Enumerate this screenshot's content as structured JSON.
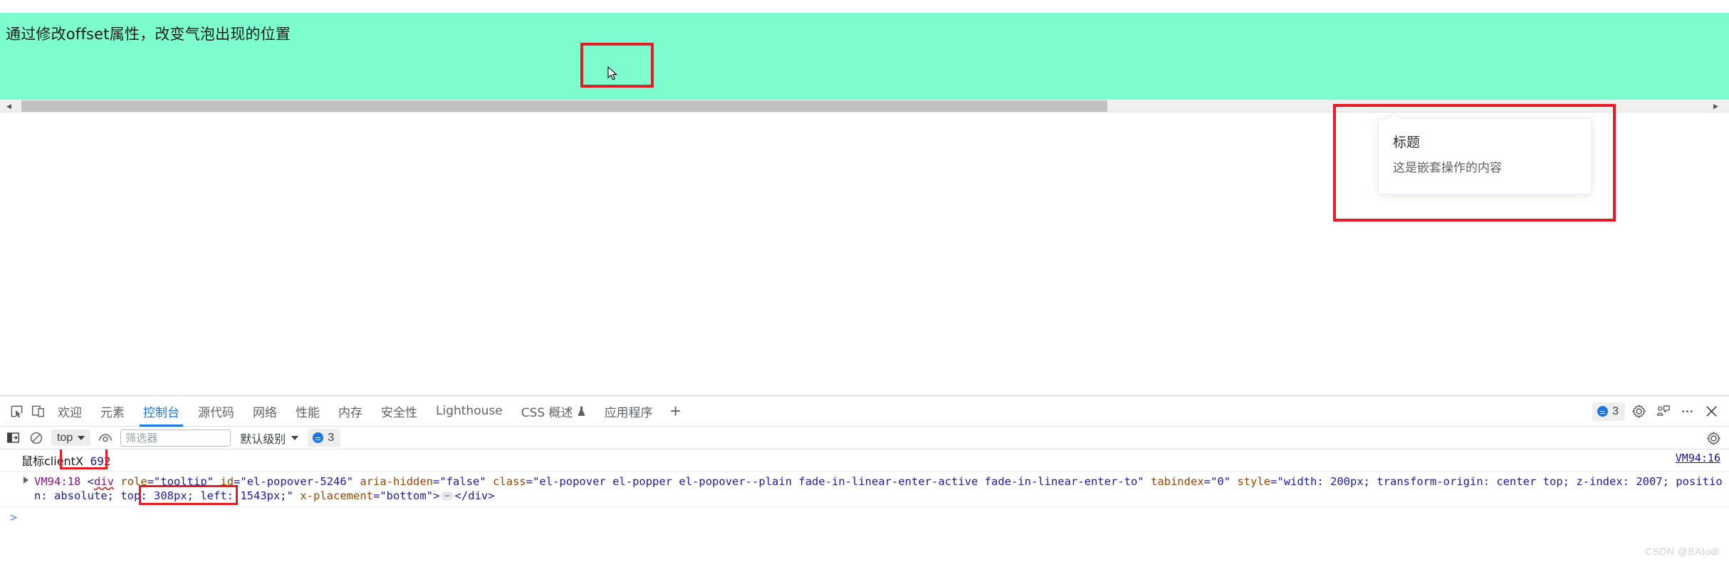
{
  "page": {
    "banner_text": "通过修改offset属性，改变气泡出现的位置",
    "popover": {
      "title": "标题",
      "content": "这是嵌套操作的内容"
    }
  },
  "devtools": {
    "tabs": [
      {
        "label": "欢迎",
        "active": false
      },
      {
        "label": "元素",
        "active": false
      },
      {
        "label": "控制台",
        "active": true
      },
      {
        "label": "源代码",
        "active": false
      },
      {
        "label": "网络",
        "active": false
      },
      {
        "label": "性能",
        "active": false
      },
      {
        "label": "内存",
        "active": false
      },
      {
        "label": "安全性",
        "active": false
      },
      {
        "label": "Lighthouse",
        "active": false
      },
      {
        "label": "CSS 概述",
        "active": false,
        "icon": "flask-icon"
      },
      {
        "label": "应用程序",
        "active": false
      }
    ],
    "add_tab_label": "+",
    "issues_count": "3",
    "console_toolbar": {
      "context": "top",
      "filter_placeholder": "筛选器",
      "level": "默认级别",
      "issues_count": "3"
    },
    "console": {
      "log_message_prefix": "鼠标clientX",
      "log_message_value": "692",
      "log_source": "VM94:16",
      "dom_source": "VM94:18",
      "dom_tag": "div",
      "dom_attrs": [
        {
          "name": "role",
          "value": "tooltip"
        },
        {
          "name": "id",
          "value": "el-popover-5246"
        },
        {
          "name": "aria-hidden",
          "value": "false"
        },
        {
          "name": "class",
          "value": "el-popover el-popper el-popover--plain fade-in-linear-enter-active fade-in-linear-enter-to"
        },
        {
          "name": "tabindex",
          "value": "0"
        },
        {
          "name": "style",
          "value": "width: 200px; transform-origin: center top; z-index: 2007; position: absolute; top: 308px; left: 1543px;"
        },
        {
          "name": "x-placement",
          "value": "bottom"
        }
      ],
      "dom_style_width": "width: 200px;",
      "dom_style_origin": "transform-origin: center top;",
      "dom_style_zindex": "z-index: 2007;",
      "dom_style_position": "position: absolute;",
      "dom_style_top": "top: 308px;",
      "dom_style_left": "left: 1543px;",
      "dom_close_tag": "</div>",
      "prompt_symbol": ">"
    }
  },
  "watermark": "CSDN @BAtodl",
  "colors": {
    "banner": "#7dfcd0",
    "annotation": "#e81b23",
    "accent": "#1a73e8",
    "link": "#1a0dab"
  }
}
